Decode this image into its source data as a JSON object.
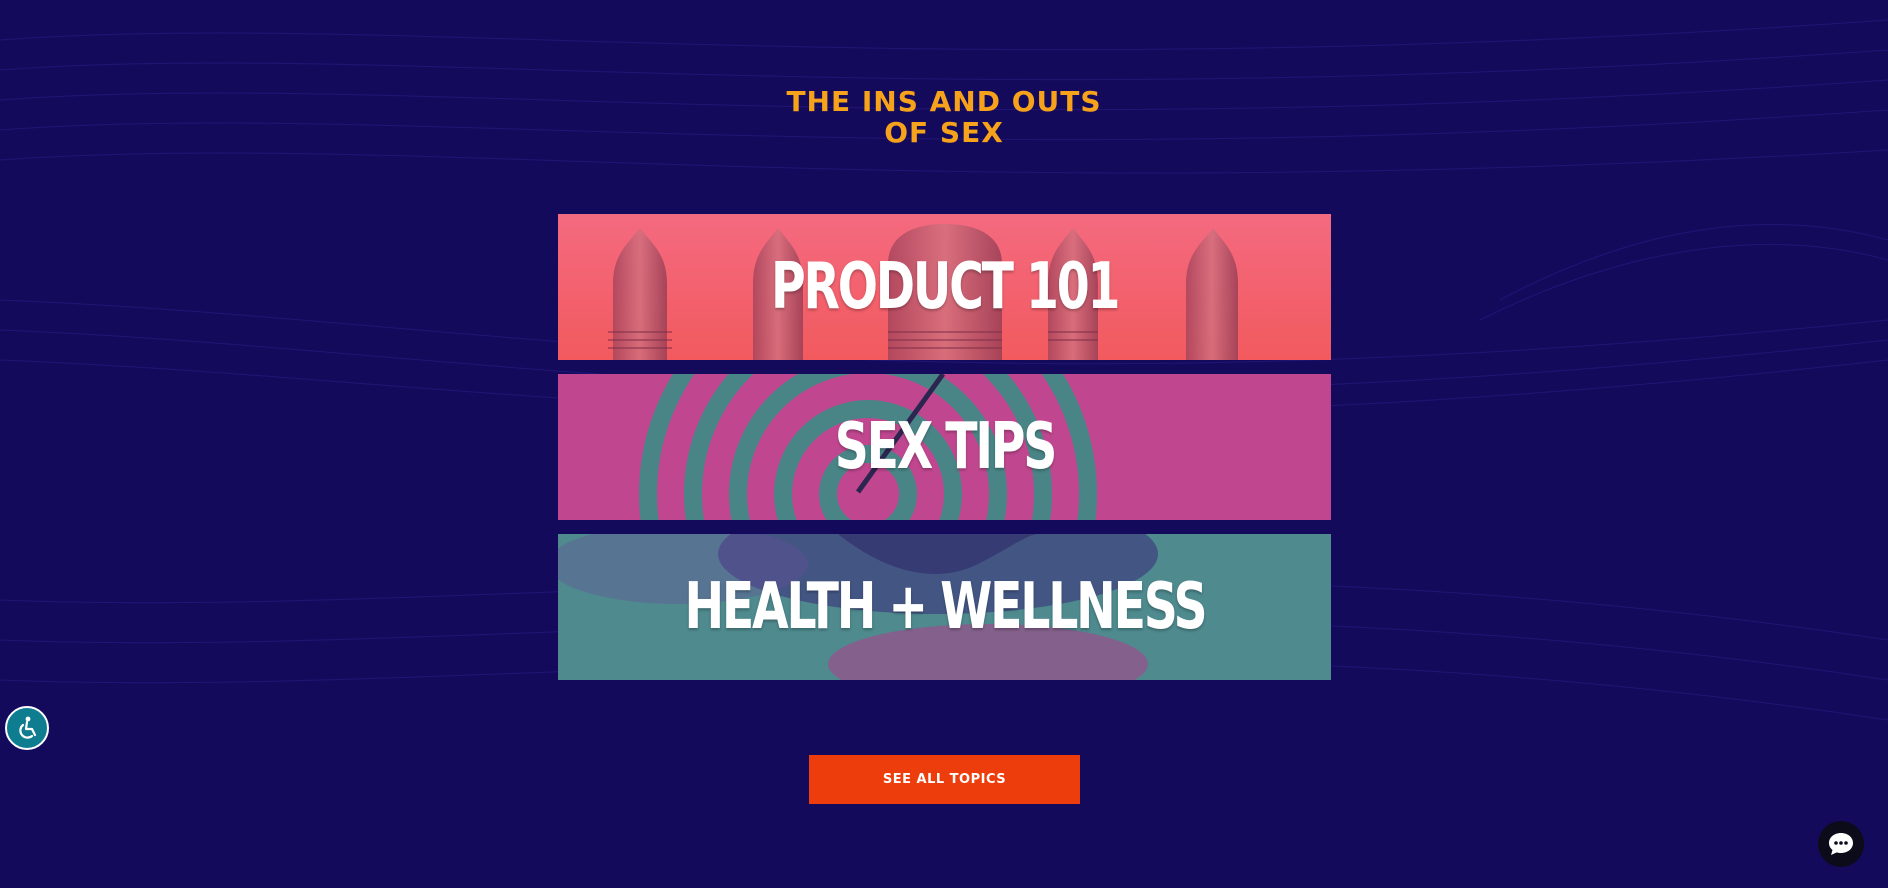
{
  "section": {
    "title_line1": "THE INS AND OUTS",
    "title_line2": "OF SEX"
  },
  "topics": [
    {
      "label": "PRODUCT 101"
    },
    {
      "label": "SEX TIPS"
    },
    {
      "label": "HEALTH + WELLNESS"
    }
  ],
  "cta": {
    "label": "SEE ALL TOPICS"
  },
  "icons": {
    "accessibility": "accessibility-icon",
    "chat": "chat-bubble-icon"
  },
  "colors": {
    "background": "#140a5c",
    "title": "#f7a21b",
    "cta": "#ee3d0c",
    "product_banner": "#f0606e",
    "tips_banner": "#c0478f",
    "health_banner": "#4e8a8e"
  }
}
